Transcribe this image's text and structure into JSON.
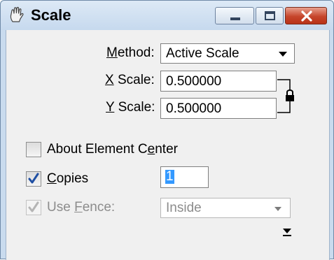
{
  "window": {
    "title": "Scale",
    "app_icon": "hand-tool-icon",
    "controls": {
      "minimize": "minimize-icon",
      "maximize": "maximize-icon",
      "close": "close-icon"
    }
  },
  "form": {
    "method_label": "Method:",
    "method_value": "Active Scale",
    "x_scale_label": "X Scale:",
    "x_scale_value": "0.500000",
    "y_scale_label": "Y Scale:",
    "y_scale_value": "0.500000",
    "lock_icon": "lock-icon",
    "about_center_label": "About Element Center",
    "about_center_checked": false,
    "copies_label": "Copies",
    "copies_checked": true,
    "copies_value": "1",
    "use_fence_label": "Use Fence:",
    "use_fence_checked": true,
    "use_fence_enabled": false,
    "fence_mode_value": "Inside",
    "expand_icon": "expand-down-icon"
  },
  "colors": {
    "title_bar": "#c6d9ee",
    "close_button": "#c6452b",
    "selection": "#3399ff",
    "check": "#1f4fa3",
    "disabled_text": "#8c8c8c"
  }
}
